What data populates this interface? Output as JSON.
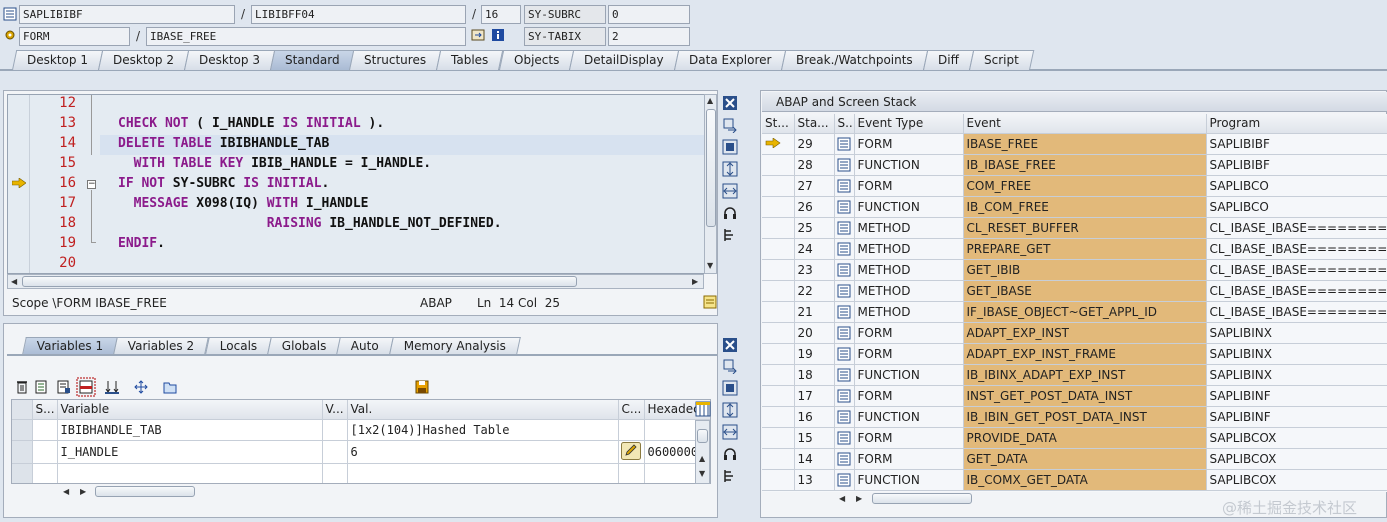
{
  "header": {
    "program": "SAPLIBIBF",
    "include": "LIBIBFF04",
    "line_no": "16",
    "subrc_label": "SY-SUBRC",
    "subrc_value": "0",
    "block_type": "FORM",
    "block_name": "IBASE_FREE",
    "tabix_label": "SY-TABIX",
    "tabix_value": "2",
    "separator": "/"
  },
  "tabs": [
    "Desktop 1",
    "Desktop 2",
    "Desktop 3",
    "Standard",
    "Structures",
    "Tables",
    "Objects",
    "DetailDisplay",
    "Data Explorer",
    "Break./Watchpoints",
    "Diff",
    "Script"
  ],
  "active_tab": "Standard",
  "source": {
    "line_numbers": [
      "12",
      "13",
      "14",
      "15",
      "16",
      "17",
      "18",
      "19",
      "20"
    ],
    "lines": [
      "",
      "CHECK NOT ( I_HANDLE IS INITIAL ).",
      "DELETE TABLE IBIBHANDLE_TAB",
      "  WITH TABLE KEY IBIB_HANDLE = I_HANDLE.",
      "IF NOT SY-SUBRC IS INITIAL.",
      "  MESSAGE X098(IQ) WITH I_HANDLE",
      "                   RAISING IB_HANDLE_NOT_DEFINED.",
      "ENDIF.",
      ""
    ],
    "current_line": "16",
    "highlight_line": "14"
  },
  "status_bar": {
    "scope": "Scope \\FORM IBASE_FREE",
    "language": "ABAP",
    "position": "Ln  14 Col  25"
  },
  "var_tabs": [
    "Variables 1",
    "Variables 2",
    "Locals",
    "Globals",
    "Auto",
    "Memory Analysis"
  ],
  "var_active_tab": "Variables 1",
  "variables": {
    "columns": [
      "S...",
      "Variable",
      "V...",
      "Val.",
      "C...",
      "Hexadec"
    ],
    "rows": [
      {
        "name": "IBIBHANDLE_TAB",
        "value": "[1x2(104)]Hashed Table",
        "hex": ""
      },
      {
        "name": "I_HANDLE",
        "value": "6",
        "hex": "0600000"
      }
    ]
  },
  "stack": {
    "title": "ABAP and Screen Stack",
    "columns": [
      "St...",
      "Sta...",
      "S...",
      "Event Type",
      "Event",
      "Program"
    ],
    "rows": [
      {
        "level": "29",
        "type": "FORM",
        "event": "IBASE_FREE",
        "program": "SAPLIBIBF",
        "current": true
      },
      {
        "level": "28",
        "type": "FUNCTION",
        "event": "IB_IBASE_FREE",
        "program": "SAPLIBIBF"
      },
      {
        "level": "27",
        "type": "FORM",
        "event": "COM_FREE",
        "program": "SAPLIBCO"
      },
      {
        "level": "26",
        "type": "FUNCTION",
        "event": "IB_COM_FREE",
        "program": "SAPLIBCO"
      },
      {
        "level": "25",
        "type": "METHOD",
        "event": "CL_RESET_BUFFER",
        "program": "CL_IBASE_IBASE=========="
      },
      {
        "level": "24",
        "type": "METHOD",
        "event": "PREPARE_GET",
        "program": "CL_IBASE_IBASE=========="
      },
      {
        "level": "23",
        "type": "METHOD",
        "event": "GET_IBIB",
        "program": "CL_IBASE_IBASE=========="
      },
      {
        "level": "22",
        "type": "METHOD",
        "event": "GET_IBASE",
        "program": "CL_IBASE_IBASE=========="
      },
      {
        "level": "21",
        "type": "METHOD",
        "event": "IF_IBASE_OBJECT~GET_APPL_ID",
        "program": "CL_IBASE_IBASE=========="
      },
      {
        "level": "20",
        "type": "FORM",
        "event": "ADAPT_EXP_INST",
        "program": "SAPLIBINX"
      },
      {
        "level": "19",
        "type": "FORM",
        "event": "ADAPT_EXP_INST_FRAME",
        "program": "SAPLIBINX"
      },
      {
        "level": "18",
        "type": "FUNCTION",
        "event": "IB_IBINX_ADAPT_EXP_INST",
        "program": "SAPLIBINX"
      },
      {
        "level": "17",
        "type": "FORM",
        "event": "INST_GET_POST_DATA_INST",
        "program": "SAPLIBINF"
      },
      {
        "level": "16",
        "type": "FUNCTION",
        "event": "IB_IBIN_GET_POST_DATA_INST",
        "program": "SAPLIBINF"
      },
      {
        "level": "15",
        "type": "FORM",
        "event": "PROVIDE_DATA",
        "program": "SAPLIBCOX"
      },
      {
        "level": "14",
        "type": "FORM",
        "event": "GET_DATA",
        "program": "SAPLIBCOX"
      },
      {
        "level": "13",
        "type": "FUNCTION",
        "event": "IB_COMX_GET_DATA",
        "program": "SAPLIBCOX"
      }
    ]
  },
  "watermark": "@稀土掘金技术社区",
  "colors": {
    "accent": "#aabbd4",
    "event_bg": "#e2b97a",
    "keyword": "#8b1a8b",
    "line_number": "#c02020",
    "arrow": "#e8b400"
  }
}
